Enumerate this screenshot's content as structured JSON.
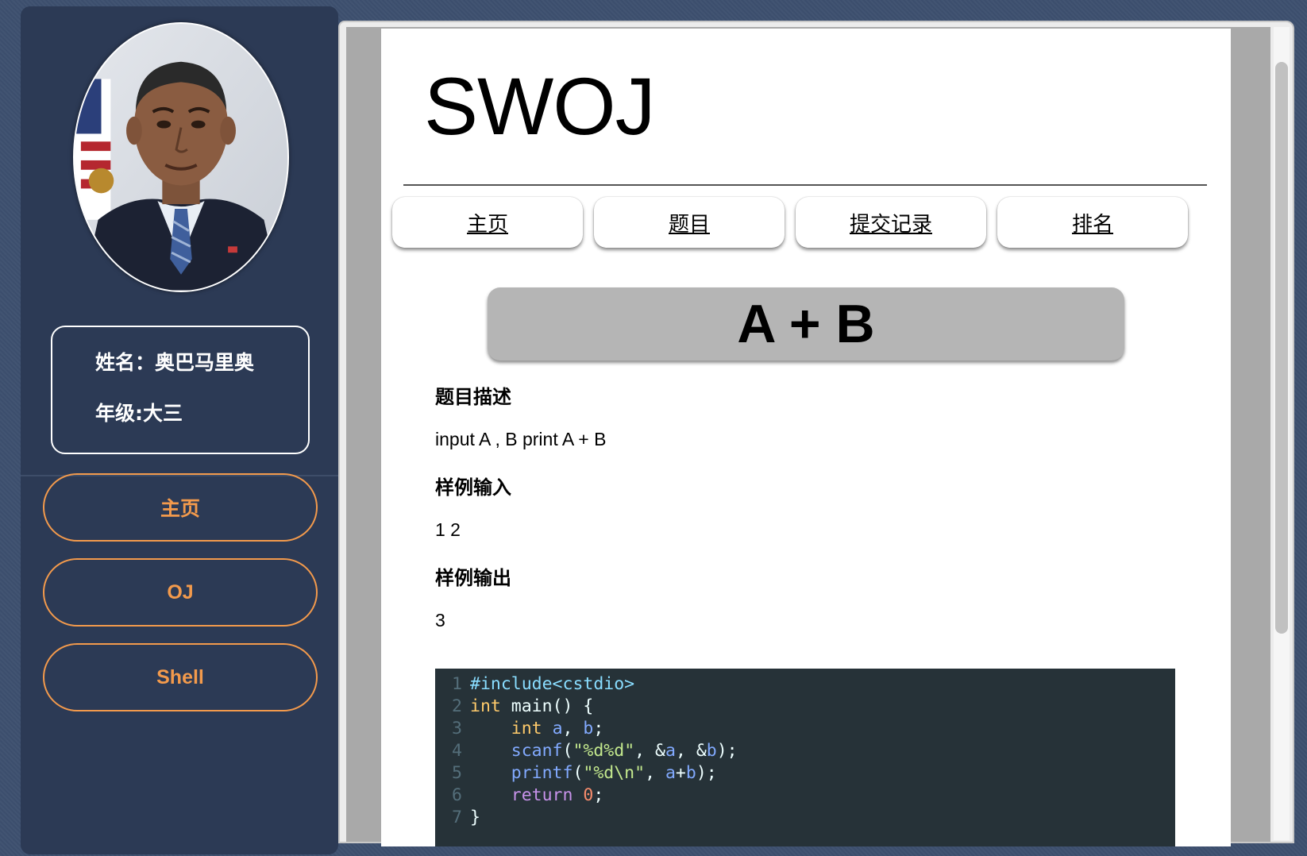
{
  "sidebar": {
    "name_line": "姓名：奥巴马里奥",
    "grade_line": "年级:大三",
    "buttons": [
      {
        "label": "主页"
      },
      {
        "label": "OJ"
      },
      {
        "label": "Shell"
      }
    ]
  },
  "site": {
    "title": "SWOJ",
    "nav": [
      {
        "label": "主页"
      },
      {
        "label": "题目"
      },
      {
        "label": "提交记录"
      },
      {
        "label": "排名"
      }
    ]
  },
  "problem": {
    "title": "A + B",
    "description_heading": "题目描述",
    "description": "input A , B print A + B",
    "sample_input_heading": "样例输入",
    "sample_input": "1 2",
    "sample_output_heading": "样例输出",
    "sample_output": "3"
  },
  "code": {
    "line_numbers": [
      "1",
      "2",
      "3",
      "4",
      "5",
      "6",
      "7"
    ],
    "lines": [
      "#include<cstdio>",
      "int main() {",
      "    int a, b;",
      "    scanf(\"%d%d\", &a, &b);",
      "    printf(\"%d\\n\", a+b);",
      "    return 0;",
      "}"
    ]
  },
  "colors": {
    "sidebar_bg": "#2c3a55",
    "accent_orange": "#f39a4c",
    "page_bg": "#3d506f",
    "code_bg": "#263238"
  }
}
